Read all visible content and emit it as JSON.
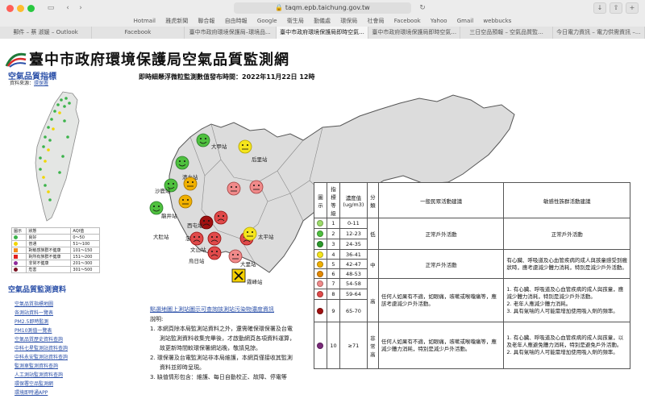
{
  "browser": {
    "url": "taqm.epb.taichung.gov.tw",
    "bookmarks": [
      "Hotmail",
      "雅虎新聞",
      "聯合報",
      "自由時報",
      "Google",
      "衛生局",
      "勤儀處",
      "環保局",
      "社會局",
      "Facebook",
      "Yahoo",
      "Gmail",
      "webbucks"
    ],
    "tabs": [
      {
        "label": "郵件 – 蔡 淑媛 – Outlook"
      },
      {
        "label": "Facebook"
      },
      {
        "label": "臺中市政府環境保護局–環境品..."
      },
      {
        "label": "臺中市政府環境保護局即時空氣..."
      },
      {
        "label": "臺中市政府環境保護局即時空氣..."
      },
      {
        "label": "三日空品預報 – 空氣品質監..."
      },
      {
        "label": "今日電力資訊 – 電力供需資訊 –..."
      }
    ],
    "active_tab": 3
  },
  "site": {
    "title": "臺中市政府環境保護局空氣品質監測網"
  },
  "sidebar": {
    "aqi_heading": "空氣品質指標",
    "source_prefix": "資料來源：",
    "source_link": "環保署",
    "legend_headers": [
      "圖示",
      "狀態",
      "AQI值"
    ],
    "legend": [
      {
        "status": "良好",
        "range": "0～50",
        "color": "#3bb34a"
      },
      {
        "status": "普通",
        "range": "51～100",
        "color": "#f2d600"
      },
      {
        "status": "對敏感族群不健康",
        "range": "101～150",
        "color": "#f28c1a"
      },
      {
        "status": "對所有族群不健康",
        "range": "151～200",
        "color": "#e02020"
      },
      {
        "status": "非常不健康",
        "range": "201～300",
        "color": "#8e2a9a"
      },
      {
        "status": "危害",
        "range": "301～500",
        "color": "#7a1020"
      }
    ],
    "monitor_heading": "空氣品質監測資料",
    "links": [
      "空氣品質指標地圖",
      "各測站資料一覽表",
      "PM2.5即時監測",
      "PM10測值一覽表",
      "空氣品質歷史資料查詢",
      "中科七星監測站資料查詢",
      "中科永安監測站資料查詢",
      "監測車監測資料查詢",
      "人工測站監測資料查詢",
      "環保署空品監測網",
      "環境即時通APP"
    ]
  },
  "main": {
    "timestamp": "即時細懸浮微粒監測數值發布時間：2022年11月22日 12時",
    "stations": [
      {
        "name": "大甲站"
      },
      {
        "name": "后里站"
      },
      {
        "name": "清水站"
      },
      {
        "name": "沙鹿站"
      },
      {
        "name": "龍井站"
      },
      {
        "name": "大肚站"
      },
      {
        "name": "西屯站"
      },
      {
        "name": "忠明站"
      },
      {
        "name": "文山站"
      },
      {
        "name": "烏日站"
      },
      {
        "name": "大里站"
      },
      {
        "name": "太平站"
      },
      {
        "name": "霧峰站"
      }
    ],
    "notes_link": "點選地圖上測站圖示可查詢該測站污染物濃度資訊",
    "notes_heading": "說明:",
    "notes": [
      "1. 本網頁除本局監測站資料之外，還需確保環保署及台電",
      "測站監測資料收集完畢後，才啟動網頁各項資料運算，",
      "故更新時間較環保署網站晚，敬請見諒。",
      "2. 環保署及台電監測站非本局維護，本網頁僅接收其監測",
      "資料並即時呈現。",
      "3. 缺值情形包含：維護、每日自動校正、故障、停電等"
    ]
  },
  "table": {
    "headers": {
      "icon": "圖示",
      "level": "指標等級",
      "conc": "濃度值 (ug/m3)",
      "cls": "分類",
      "general": "一般民眾活動建議",
      "sensitive": "敏感性族群活動建議"
    },
    "rows": [
      {
        "level": "1",
        "range": "0-11",
        "color": "#9ddc6a"
      },
      {
        "level": "2",
        "range": "12-23",
        "color": "#4fc03f"
      },
      {
        "level": "3",
        "range": "24-35",
        "color": "#2c9a2c"
      },
      {
        "level": "4",
        "range": "36-41",
        "color": "#f5e51c"
      },
      {
        "level": "5",
        "range": "42-47",
        "color": "#f0b000"
      },
      {
        "level": "6",
        "range": "48-53",
        "color": "#e58a00"
      },
      {
        "level": "7",
        "range": "54-58",
        "color": "#f08a8a"
      },
      {
        "level": "8",
        "range": "59-64",
        "color": "#e04a4a"
      },
      {
        "level": "9",
        "range": "65-70",
        "color": "#a01010"
      },
      {
        "level": "10",
        "range": "≥71",
        "color": "#7a2a7a"
      }
    ],
    "class_low": "低",
    "class_mid": "中",
    "class_high": "高",
    "class_vhigh": "非常高",
    "adv_low_general": "正常戶外活動",
    "adv_low_sensitive": "正常戶外活動",
    "adv_mid_general": "正常戶外活動",
    "adv_mid_sensitive": "有心臟、呼吸道及心血管疾病的成人與孩童感受到癥狀時，應考慮減少體力消耗，特別是減少戶外活動。",
    "adv_high_general": "任何人如果有不適，如眼痛，咳嗽或喉嚨痛等，應該考慮減少戶外活動。",
    "adv_high_sensitive": [
      "1. 有心臟、呼吸道及心血管疾病的成人與孩童，應減少體力消耗，特別是減少戶外活動。",
      "2. 老年人應減少體力消耗。",
      "3. 具有氣喘的人可能需增加使用吸入劑的頻率。"
    ],
    "adv_vhigh_general": "任何人如果有不適，如眼痛，咳嗽或喉嚨痛等，應減少體力消耗，特別是減少戶外活動。",
    "adv_vhigh_sensitive": [
      "1. 有心臟、呼吸道及心血管疾病的成人與孩童，以及老年人應避免體力消耗，特別是避免戶外活動。",
      "2. 具有氣喘的人可能需增加使用吸入劑的頻率。"
    ]
  }
}
